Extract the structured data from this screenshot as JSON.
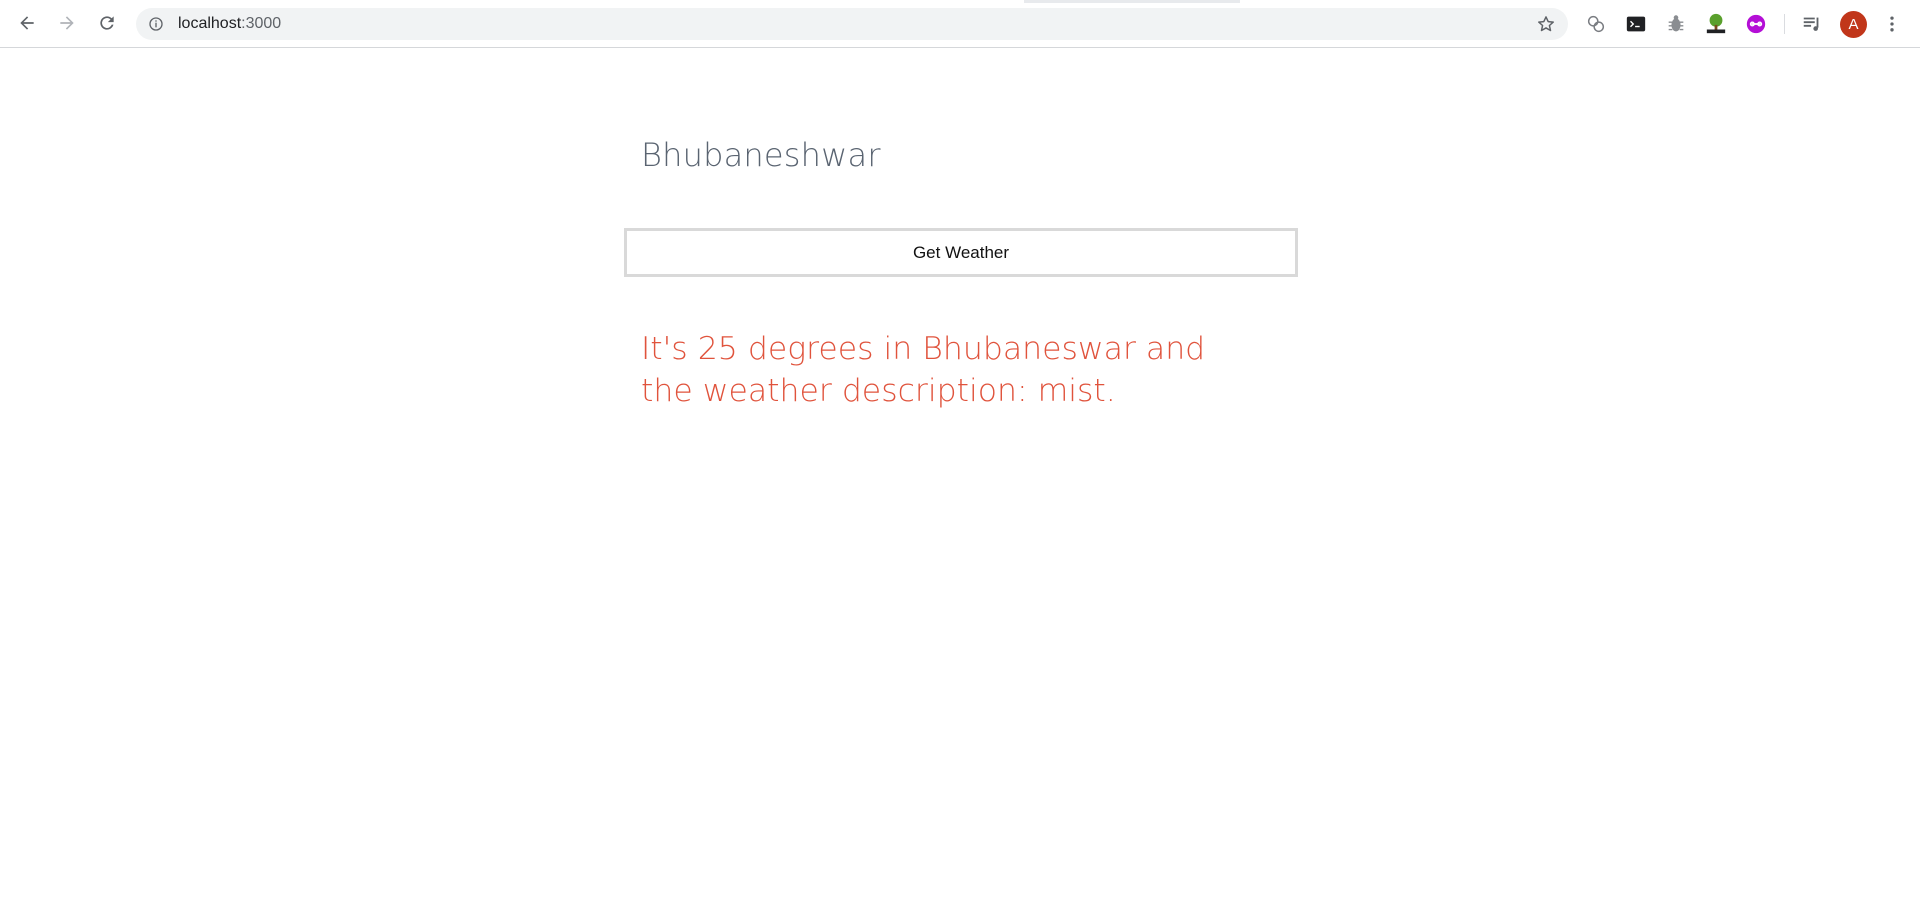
{
  "browser": {
    "url_host": "localhost",
    "url_port": ":3000",
    "avatar_letter": "A",
    "icons": [
      "back-icon",
      "forward-icon",
      "reload-icon",
      "info-icon",
      "star-icon",
      "extensions-icon",
      "terminal-icon",
      "bug-icon",
      "tree-icon",
      "purple-ext-icon",
      "playlist-icon",
      "more-icon"
    ]
  },
  "page": {
    "city": "Bhubaneshwar",
    "button_label": "Get Weather",
    "result": "It's 25 degrees in Bhubaneswar and the weather description: mist."
  },
  "colors": {
    "result_text": "#e0533c",
    "city_text": "#5a6471",
    "avatar_bg": "#c1361a"
  }
}
